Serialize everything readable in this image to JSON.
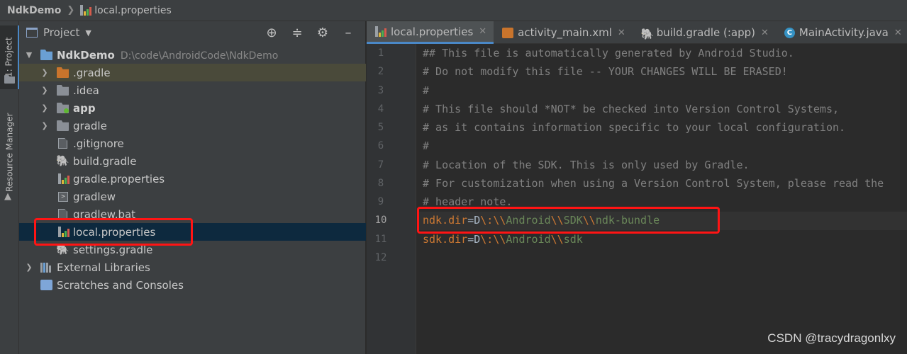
{
  "navbar": {
    "project": "NdkDemo",
    "file": "local.properties"
  },
  "toolstrip": {
    "project_tab": "1: Project",
    "resource_tab": "Resource Manager"
  },
  "panel": {
    "title": "Project",
    "tree": [
      {
        "label": "NdkDemo",
        "path": "D:\\code\\AndroidCode\\NdkDemo"
      },
      {
        "label": ".gradle"
      },
      {
        "label": ".idea"
      },
      {
        "label": "app"
      },
      {
        "label": "gradle"
      },
      {
        "label": ".gitignore"
      },
      {
        "label": "build.gradle"
      },
      {
        "label": "gradle.properties"
      },
      {
        "label": "gradlew"
      },
      {
        "label": "gradlew.bat"
      },
      {
        "label": "local.properties"
      },
      {
        "label": "settings.gradle"
      },
      {
        "label": "External Libraries"
      },
      {
        "label": "Scratches and Consoles"
      }
    ]
  },
  "tabs": [
    {
      "label": "local.properties"
    },
    {
      "label": "activity_main.xml"
    },
    {
      "label": "build.gradle (:app)"
    },
    {
      "label": "MainActivity.java"
    }
  ],
  "code": {
    "line_numbers": [
      "1",
      "2",
      "3",
      "4",
      "5",
      "6",
      "7",
      "8",
      "9",
      "10",
      "11",
      "12"
    ],
    "comments": [
      "## This file is automatically generated by Android Studio.",
      "# Do not modify this file -- YOUR CHANGES WILL BE ERASED!",
      "#",
      "# This file should *NOT* be checked into Version Control Systems,",
      "# as it contains information specific to your local configuration.",
      "#",
      "# Location of the SDK. This is only used by Gradle.",
      "# For customization when using a Version Control System, please read the",
      "# header note."
    ],
    "ndk_key": "ndk.dir",
    "ndk_value": [
      "D",
      "\\:",
      "\\\\",
      "Android",
      "\\\\",
      "SDK",
      "\\\\",
      "ndk-bundle"
    ],
    "sdk_key": "sdk.dir",
    "sdk_value": [
      "D",
      "\\:",
      "\\\\",
      "Android",
      "\\\\",
      "sdk"
    ],
    "equals": "="
  },
  "watermark": "CSDN @tracydragonlxy",
  "colors": {
    "accent": "#4a88c7",
    "highlight": "#ff1414",
    "selection": "#0d293e"
  }
}
